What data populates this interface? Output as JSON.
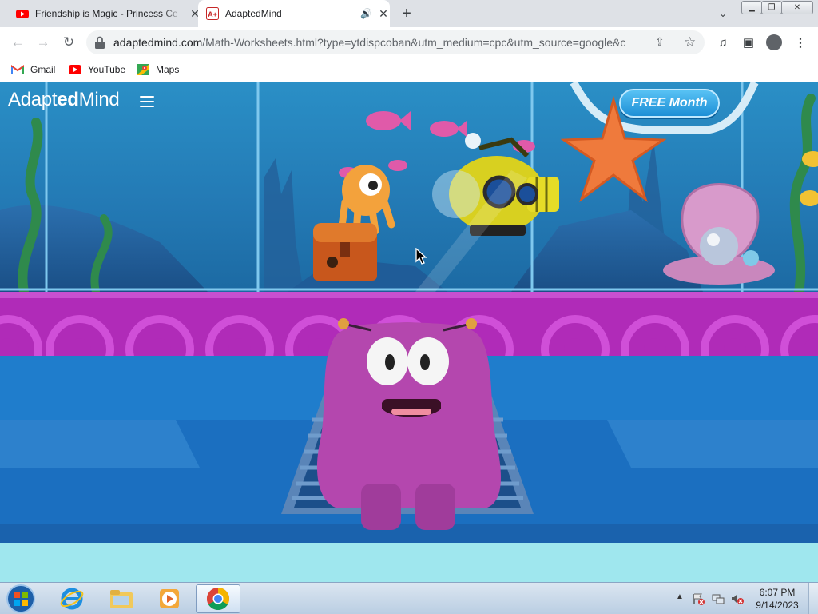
{
  "browser": {
    "tabs": [
      {
        "title": "Friendship is Magic - Princess Ce",
        "favicon": "youtube-icon",
        "active": false
      },
      {
        "title": "AdaptedMind",
        "favicon": "adaptedmind-icon",
        "active": true,
        "audio": true
      }
    ],
    "new_tab_glyph": "+",
    "url": {
      "domain": "adaptedmind.com",
      "path": "/Math-Worksheets.html?type=ytdispcoban&utm_medium=cpc&utm_source=google&ca..."
    },
    "bookmarks": [
      {
        "label": "Gmail",
        "icon": "gmail-icon"
      },
      {
        "label": "YouTube",
        "icon": "youtube-icon"
      },
      {
        "label": "Maps",
        "icon": "maps-icon"
      }
    ]
  },
  "page": {
    "logo": {
      "part1": "Adapt",
      "part2": "ed",
      "part3": "Mind"
    },
    "cta_label": "FREE Month",
    "colors": {
      "aquarium": "#2a8fc6",
      "stage_magenta": "#b02bb8",
      "floor_blue": "#1b6fc0",
      "footer": "#9fe7ee",
      "monster": "#b447ae",
      "cta": "#1d8fd6"
    }
  },
  "taskbar": {
    "apps": [
      "internet-explorer-icon",
      "windows-explorer-icon",
      "media-player-icon",
      "chrome-icon"
    ],
    "clock": {
      "time": "6:07 PM",
      "date": "9/14/2023"
    }
  }
}
